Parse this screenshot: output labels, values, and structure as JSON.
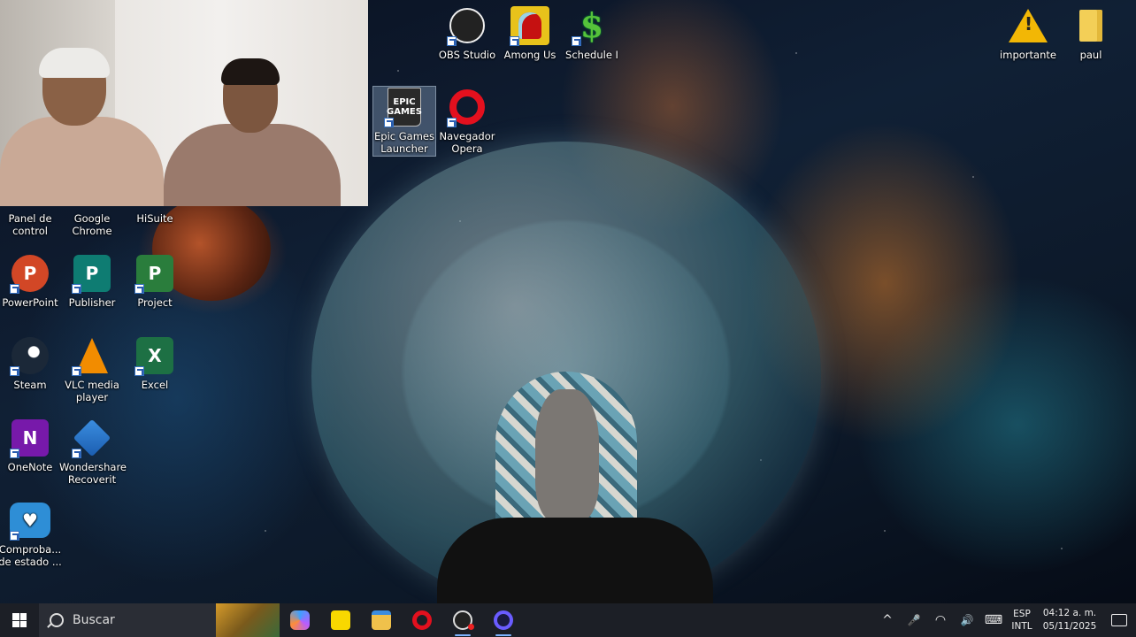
{
  "desktop": {
    "icons": {
      "obs": "OBS Studio",
      "among_us": "Among Us",
      "schedule": "Schedule I",
      "epic": "Epic Games Launcher",
      "epic_glyph": "EPIC\nGAMES",
      "opera": "Navegador Opera",
      "importante": "importante",
      "paul": "paul",
      "panel": "Panel de control",
      "chrome": "Google Chrome",
      "hisuite": "HiSuite",
      "powerpoint": "PowerPoint",
      "publisher": "Publisher",
      "project": "Project",
      "steam": "Steam",
      "vlc": "VLC media player",
      "excel": "Excel",
      "onenote": "OneNote",
      "wondershare": "Wondershare Recoverit",
      "comprobacion": "Comproba... de estado ..."
    },
    "glyph_letters": {
      "powerpoint": "P",
      "publisher": "P",
      "project": "P",
      "excel": "X",
      "onenote": "N",
      "schedule": "$",
      "health": "♥"
    }
  },
  "taskbar": {
    "search_placeholder": "Buscar",
    "language_top": "ESP",
    "language_bottom": "INTL",
    "time": "04:12 a. m.",
    "date": "05/11/2025",
    "tray_up": "^",
    "tray_mic": "🎤",
    "tray_wifi": "◠",
    "tray_volume": "🔊",
    "tray_keyboard": "⌨"
  },
  "colors": {
    "taskbar_bg": "#1c1f26",
    "accent": "#7db4ff"
  }
}
